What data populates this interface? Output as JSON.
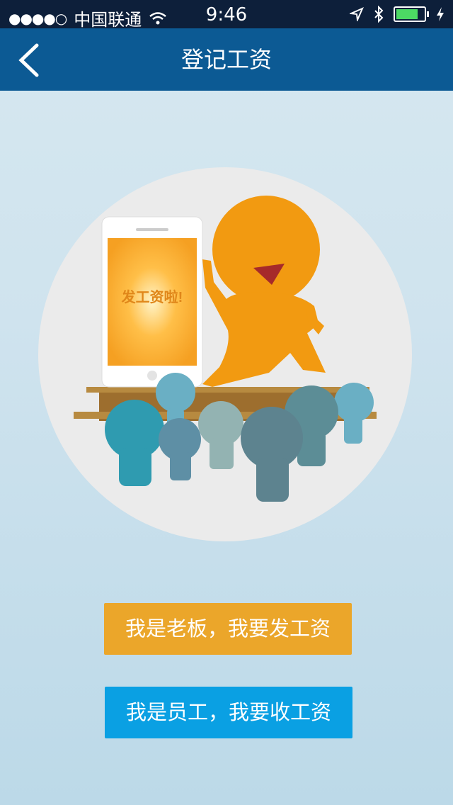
{
  "status_bar": {
    "signal_dots": "●●●●○",
    "carrier": "中国联通",
    "time": "9:46",
    "battery_percent": 80,
    "icons": [
      "wifi-icon",
      "location-icon",
      "bluetooth-icon",
      "battery-icon",
      "charging-icon"
    ]
  },
  "nav": {
    "title": "登记工资",
    "back_icon": "chevron-left-icon"
  },
  "illustration": {
    "phone_screen_text": "发工资啦!"
  },
  "buttons": {
    "boss_label": "我是老板，我要发工资",
    "employee_label": "我是员工，我要收工资"
  },
  "colors": {
    "nav_bg": "#0c5a94",
    "boss_button": "#eba62a",
    "employee_button": "#0aa0e3",
    "character_orange": "#f29a11"
  }
}
